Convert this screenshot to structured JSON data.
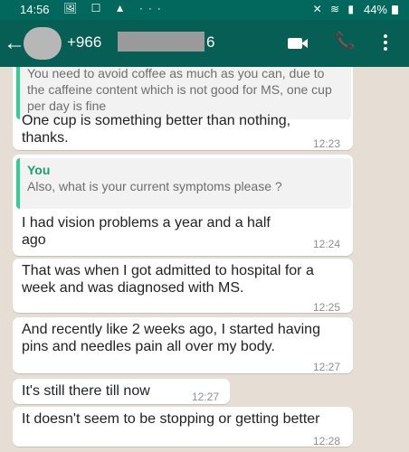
{
  "status": {
    "time": "14:56",
    "left_icons": "🖼 ☐ ▲ ···",
    "right_icons": "✕ ≋ ▮",
    "battery": "44%"
  },
  "header": {
    "contact_prefix": "+966",
    "contact_suffix": "6"
  },
  "messages": [
    {
      "quote_text": "You need to avoid coffee as much as you can, due to the caffeine content which is not good for MS, one cup per day is fine",
      "text": "One cup is something better than nothing, thanks.",
      "time": "12:23"
    },
    {
      "quote_author": "You",
      "quote_text": "Also, what is your current symptoms please ?",
      "text": "I had vision problems a year and a half ago",
      "time": "12:24"
    },
    {
      "text": "That was when I got admitted to hospital for a week and was diagnosed with MS.",
      "time": "12:25"
    },
    {
      "text": "And recently like 2 weeks ago, I started having pins and needles pain all over my body.",
      "time": "12:27"
    },
    {
      "text": "It's still there till now",
      "time": "12:27"
    },
    {
      "text": "It doesn't seem to be stopping or getting better",
      "time": "12:28"
    }
  ]
}
